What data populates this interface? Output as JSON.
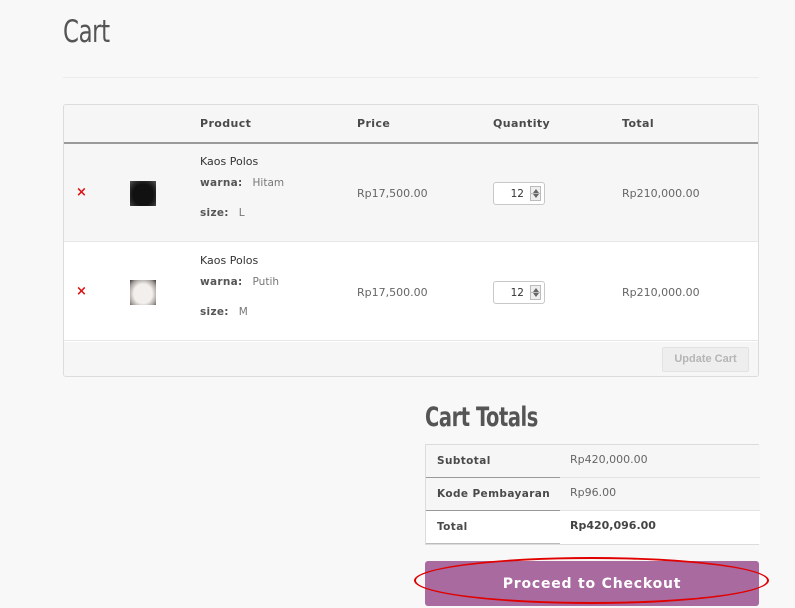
{
  "page": {
    "title": "Cart"
  },
  "cart": {
    "headers": {
      "product": "Product",
      "price": "Price",
      "quantity": "Quantity",
      "total": "Total"
    },
    "remove_symbol": "×",
    "items": [
      {
        "name": "Kaos Polos",
        "attributes": [
          {
            "key": "warna:",
            "value": "Hitam"
          },
          {
            "key": "size:",
            "value": "L"
          }
        ],
        "thumbnail": "black-tshirt-thumbnail",
        "price": "Rp17,500.00",
        "quantity": "12",
        "total": "Rp210,000.00"
      },
      {
        "name": "Kaos Polos",
        "attributes": [
          {
            "key": "warna:",
            "value": "Putih"
          },
          {
            "key": "size:",
            "value": "M"
          }
        ],
        "thumbnail": "white-tshirt-thumbnail",
        "price": "Rp17,500.00",
        "quantity": "12",
        "total": "Rp210,000.00"
      }
    ],
    "update_label": "Update Cart"
  },
  "totals": {
    "title": "Cart Totals",
    "rows": [
      {
        "label": "Subtotal",
        "value": "Rp420,000.00"
      },
      {
        "label": "Kode Pembayaran",
        "value": "Rp96.00"
      },
      {
        "label": "Total",
        "value": "Rp420,096.00"
      }
    ],
    "checkout_label": "Proceed to Checkout"
  },
  "colors": {
    "remove": "#dd1111",
    "checkout": "#a86a9f",
    "highlight": "#e00000"
  }
}
